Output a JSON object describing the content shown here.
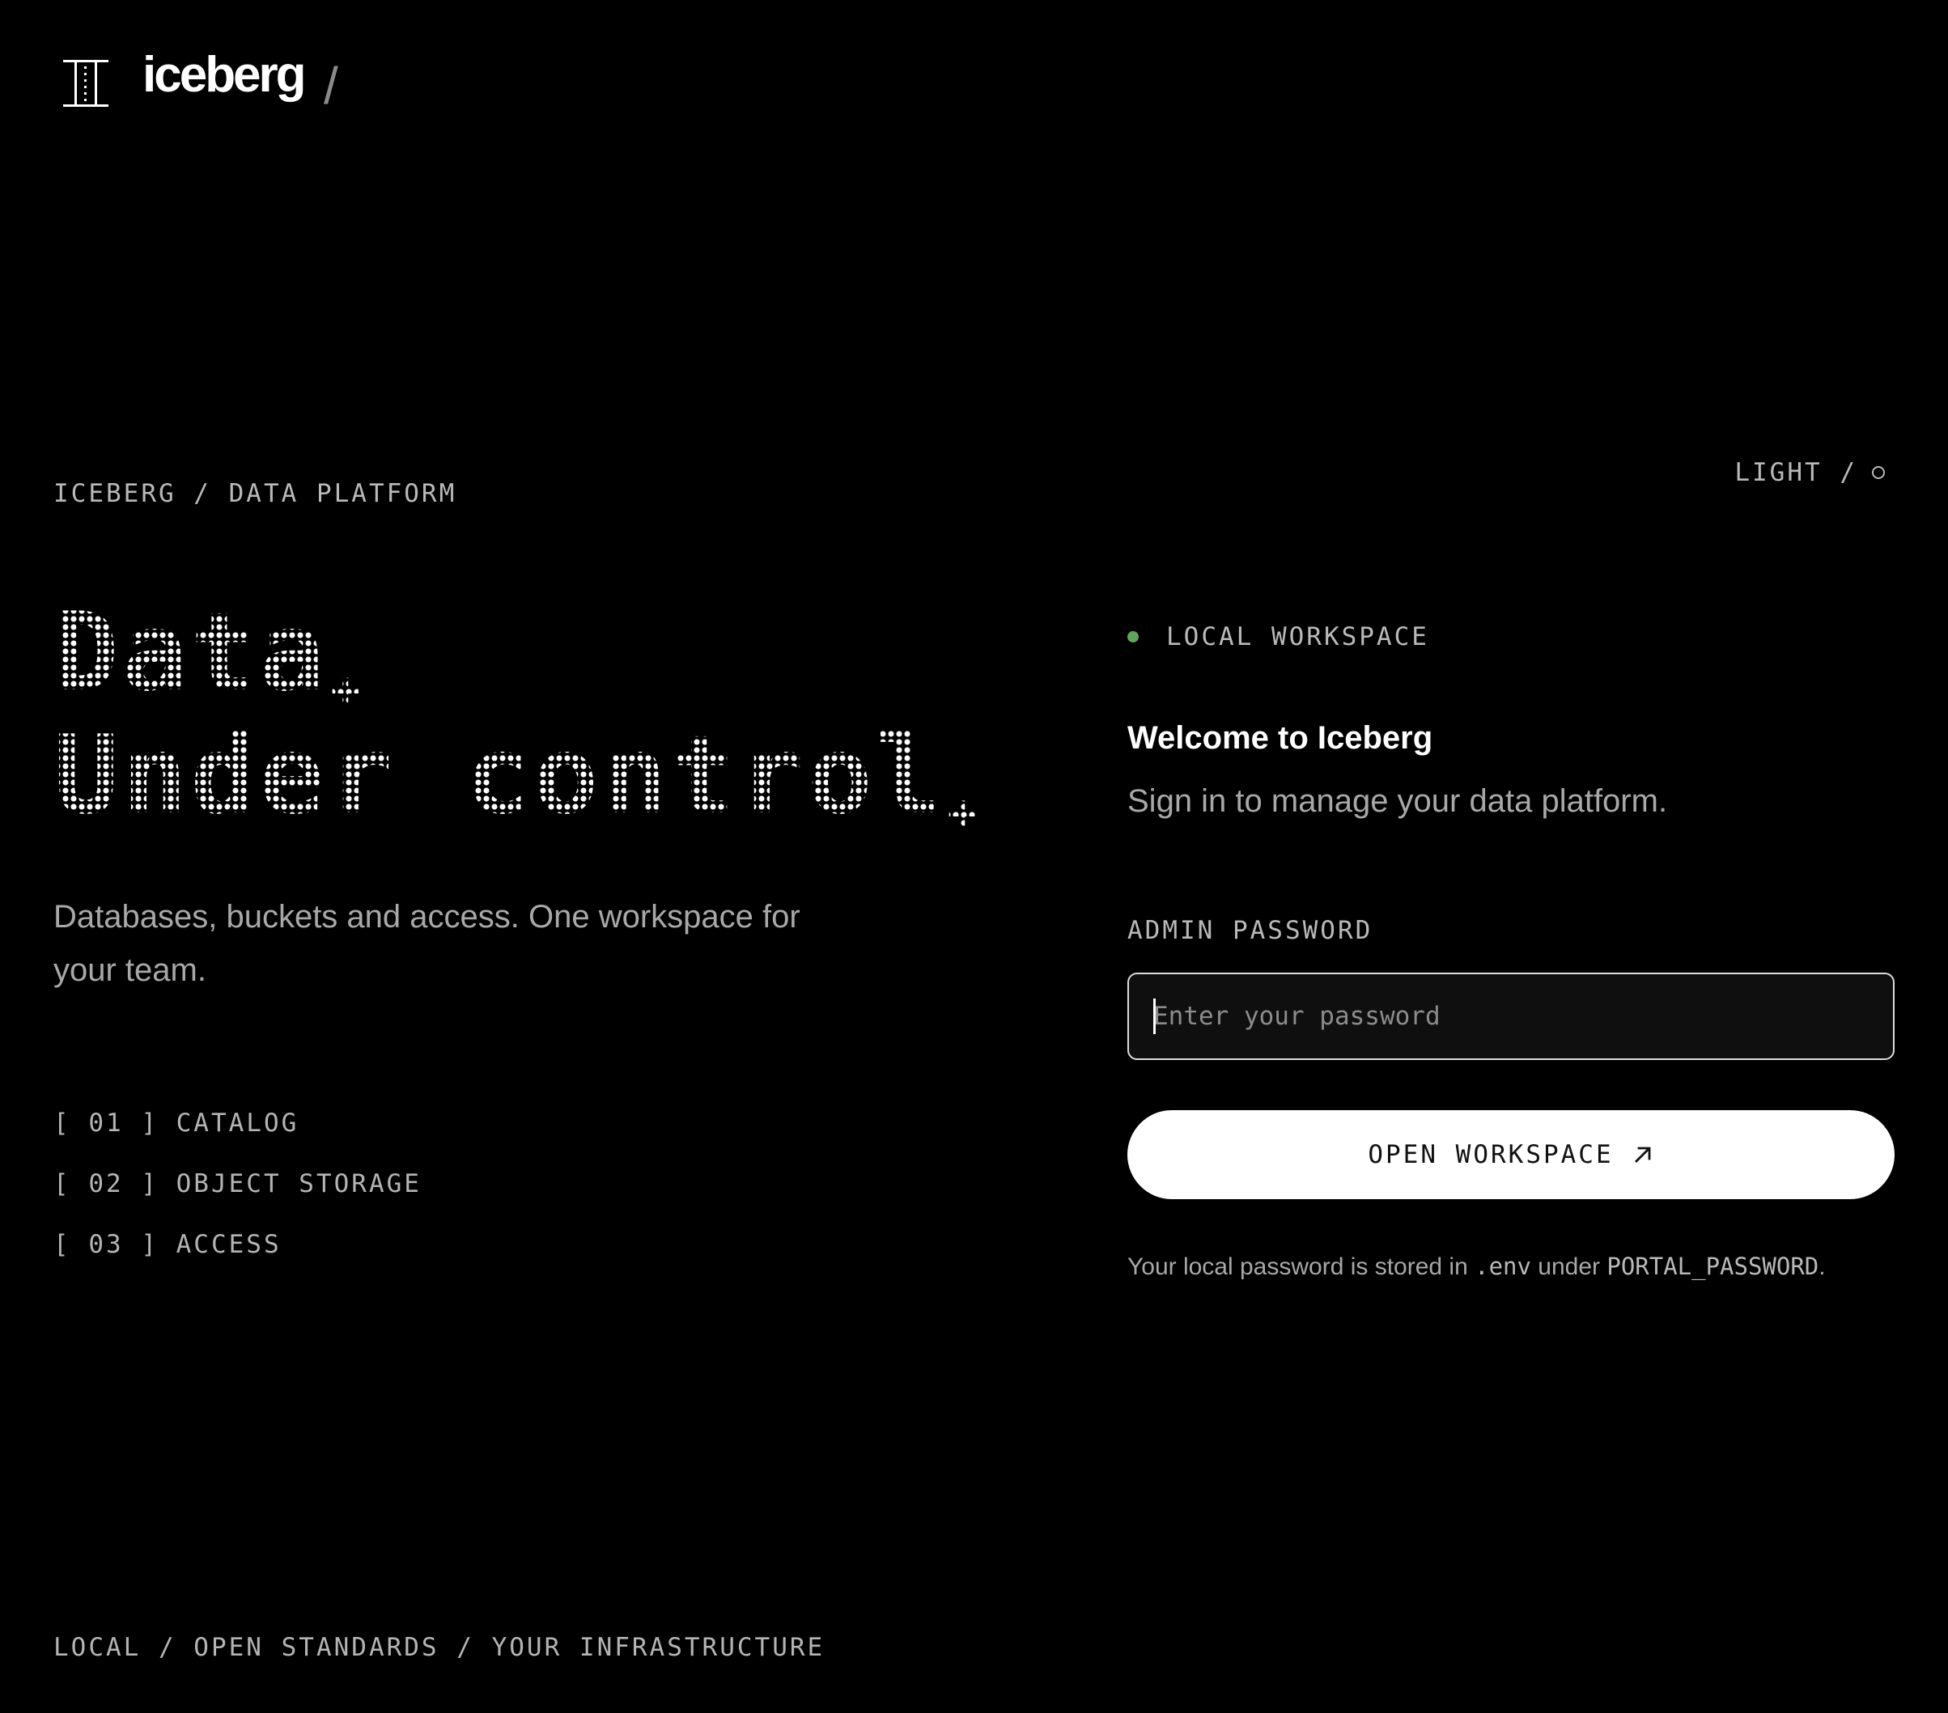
{
  "brand": {
    "name": "iceberg",
    "separator": "/",
    "logo_icon": "iceberg-logo-icon"
  },
  "eyebrow": "ICEBERG / DATA PLATFORM",
  "theme_toggle": {
    "label": "LIGHT /",
    "icon": "circle-icon"
  },
  "hero": {
    "line1": "Data",
    "line2": "Under control",
    "accent": "+"
  },
  "lede": "Databases, buckets and access. One workspace for your team.",
  "features": [
    {
      "label": "[ 01 ] CATALOG"
    },
    {
      "label": "[ 02 ] OBJECT STORAGE"
    },
    {
      "label": "[ 03 ] ACCESS"
    }
  ],
  "footer": "LOCAL / OPEN STANDARDS / YOUR INFRASTRUCTURE",
  "login": {
    "status_label": "LOCAL WORKSPACE",
    "status_color": "#62a45c",
    "welcome": "Welcome to Iceberg",
    "subtitle": "Sign in to manage your data platform.",
    "password_label": "ADMIN PASSWORD",
    "password_placeholder": "Enter your password",
    "password_value": "",
    "submit_label": "OPEN WORKSPACE",
    "submit_icon": "arrow-up-right-icon",
    "hint_prefix": "Your local password is stored in ",
    "hint_file": ".env",
    "hint_middle": " under ",
    "hint_var": "PORTAL_PASSWORD",
    "hint_suffix": "."
  },
  "colors": {
    "background": "#000000",
    "text": "#ffffff",
    "muted": "#a8a8a8",
    "button_bg": "#ffffff"
  }
}
